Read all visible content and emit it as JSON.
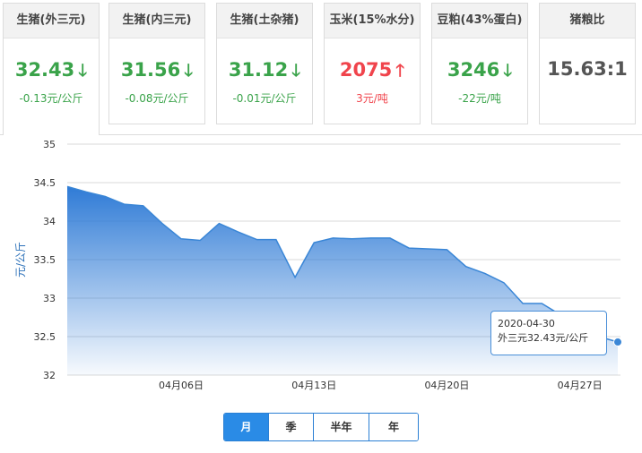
{
  "cards": [
    {
      "title": "生猪(外三元)",
      "value": "32.43",
      "arrow": "down",
      "change": "-0.13元/公斤"
    },
    {
      "title": "生猪(内三元)",
      "value": "31.56",
      "arrow": "down",
      "change": "-0.08元/公斤"
    },
    {
      "title": "生猪(土杂猪)",
      "value": "31.12",
      "arrow": "down",
      "change": "-0.01元/公斤"
    },
    {
      "title": "玉米(15%水分)",
      "value": "2075",
      "arrow": "up",
      "change": "3元/吨"
    },
    {
      "title": "豆粕(43%蛋白)",
      "value": "3246",
      "arrow": "down",
      "change": "-22元/吨"
    },
    {
      "title": "猪粮比",
      "value": "15.63:1",
      "arrow": "none",
      "change": ""
    }
  ],
  "chart_data": {
    "type": "area",
    "title": "",
    "xlabel": "",
    "ylabel": "元/公斤",
    "ylim": [
      32,
      35
    ],
    "yticks": [
      "32",
      "32.5",
      "33",
      "33.5",
      "34",
      "34.5",
      "35"
    ],
    "xticks": [
      {
        "label": "04月06日",
        "index": 7
      },
      {
        "label": "04月13日",
        "index": 14
      },
      {
        "label": "04月20日",
        "index": 21
      },
      {
        "label": "04月27日",
        "index": 28
      }
    ],
    "grid": true,
    "color": "#3a86d6",
    "series": [
      {
        "name": "外三元",
        "x": [
          "04-01",
          "04-02",
          "04-03",
          "04-04",
          "04-05",
          "04-06",
          "04-07",
          "04-08",
          "04-09",
          "04-10",
          "04-11",
          "04-12",
          "04-13",
          "04-14",
          "04-15",
          "04-16",
          "04-17",
          "04-18",
          "04-19",
          "04-20",
          "04-21",
          "04-22",
          "04-23",
          "04-24",
          "04-25",
          "04-26",
          "04-27",
          "04-28",
          "04-29",
          "04-30"
        ],
        "values": [
          34.45,
          34.38,
          34.32,
          34.22,
          34.2,
          33.97,
          33.77,
          33.75,
          33.97,
          33.86,
          33.76,
          33.76,
          33.27,
          33.72,
          33.78,
          33.77,
          33.78,
          33.78,
          33.65,
          33.64,
          33.63,
          33.41,
          33.32,
          33.2,
          32.93,
          32.93,
          32.78,
          32.66,
          32.5,
          32.43
        ]
      }
    ],
    "tooltip": {
      "date": "2020-04-30",
      "label": "外三元32.43元/公斤"
    }
  },
  "range_tabs": [
    {
      "label": "月",
      "active": true
    },
    {
      "label": "季",
      "active": false
    },
    {
      "label": "半年",
      "active": false
    },
    {
      "label": "年",
      "active": false
    }
  ]
}
